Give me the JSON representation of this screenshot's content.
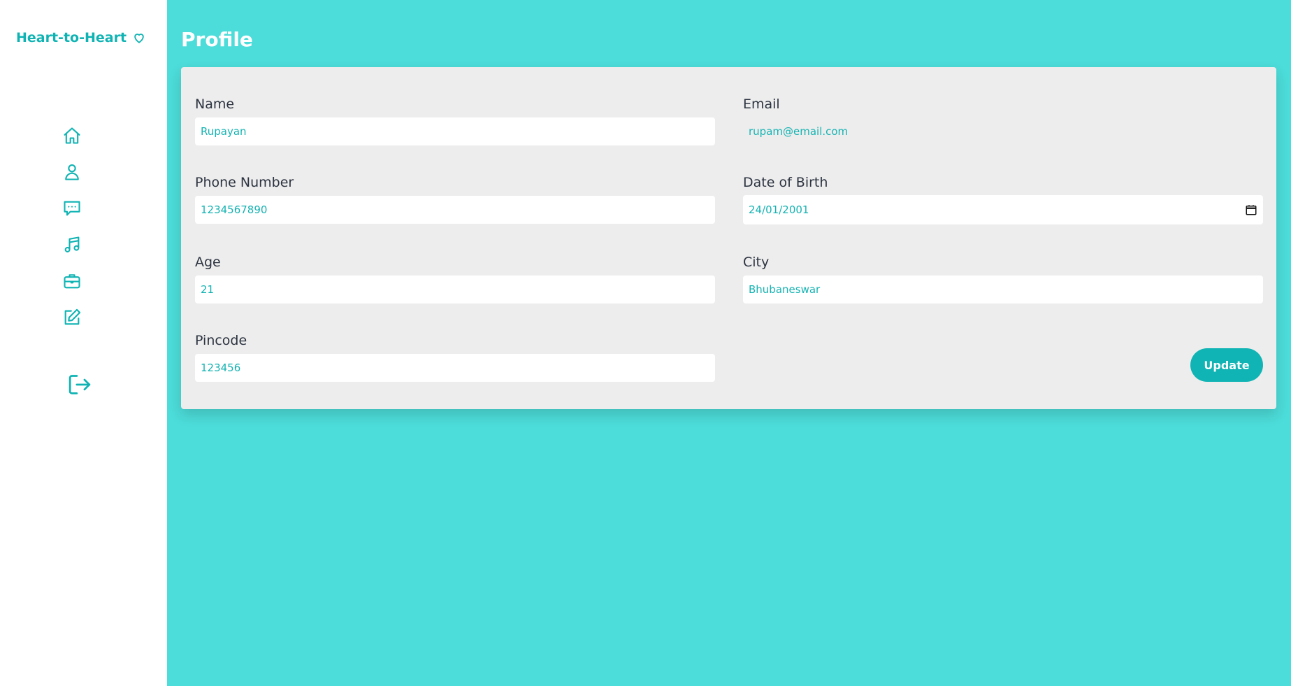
{
  "app": {
    "brand_name": "Heart-to-Heart",
    "brand_icon": "heart-icon",
    "accent_color": "#11b4b4",
    "background_color": "#4cdcd9"
  },
  "sidebar": {
    "items": [
      {
        "name": "home",
        "icon": "home-icon"
      },
      {
        "name": "profile",
        "icon": "user-icon"
      },
      {
        "name": "chat",
        "icon": "chat-icon"
      },
      {
        "name": "music",
        "icon": "music-icon"
      },
      {
        "name": "jobs",
        "icon": "briefcase-icon"
      },
      {
        "name": "edit",
        "icon": "edit-icon"
      }
    ],
    "logout_icon": "logout-icon"
  },
  "page": {
    "title": "Profile"
  },
  "form": {
    "name": {
      "label": "Name",
      "value": "Rupayan"
    },
    "email": {
      "label": "Email",
      "value": "rupam@email.com"
    },
    "phone": {
      "label": "Phone Number",
      "value": "1234567890"
    },
    "dob": {
      "label": "Date of Birth",
      "value": "24/01/2001"
    },
    "age": {
      "label": "Age",
      "value": "21"
    },
    "city": {
      "label": "City",
      "value": "Bhubaneswar"
    },
    "pincode": {
      "label": "Pincode",
      "value": "123456"
    },
    "update_label": "Update"
  }
}
